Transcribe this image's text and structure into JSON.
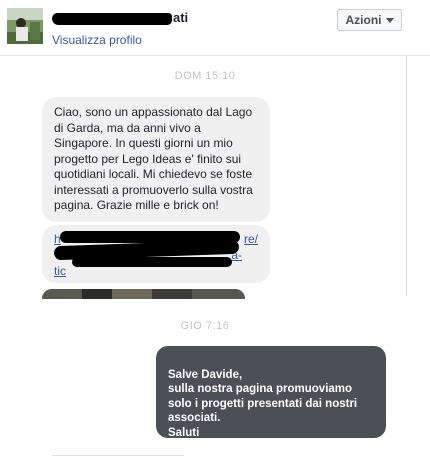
{
  "header": {
    "name_visible": "ati",
    "profile_link": "Visualizza profilo",
    "actions_label": "Azioni"
  },
  "conversation": {
    "ts_1": "DOM 15:10",
    "message_1": "Ciao, sono un appassionato dal Lago di Garda, ma da anni vivo a Singapore. In questi giorni un mio progetto per Lego Ideas e' finito sui quotidiani locali. Mi chiedevo se foste interessati a promuoverlo sulla vostra pagina. Grazie mille e brick on!",
    "link_start": "h",
    "link_end_1": "re/",
    "link_end_2": "a-",
    "link_end_3": "tic",
    "ts_2": "GIO 7:16",
    "reply": "Salve Davide,\nsulla nostra pagina promuoviamo\nsolo i progetti presentati dai nostri\nassociati.\nSaluti"
  },
  "colors": {
    "link": "#365899",
    "incoming_bubble": "#f1f0f0",
    "outgoing_bubble": "#4b4f56"
  }
}
